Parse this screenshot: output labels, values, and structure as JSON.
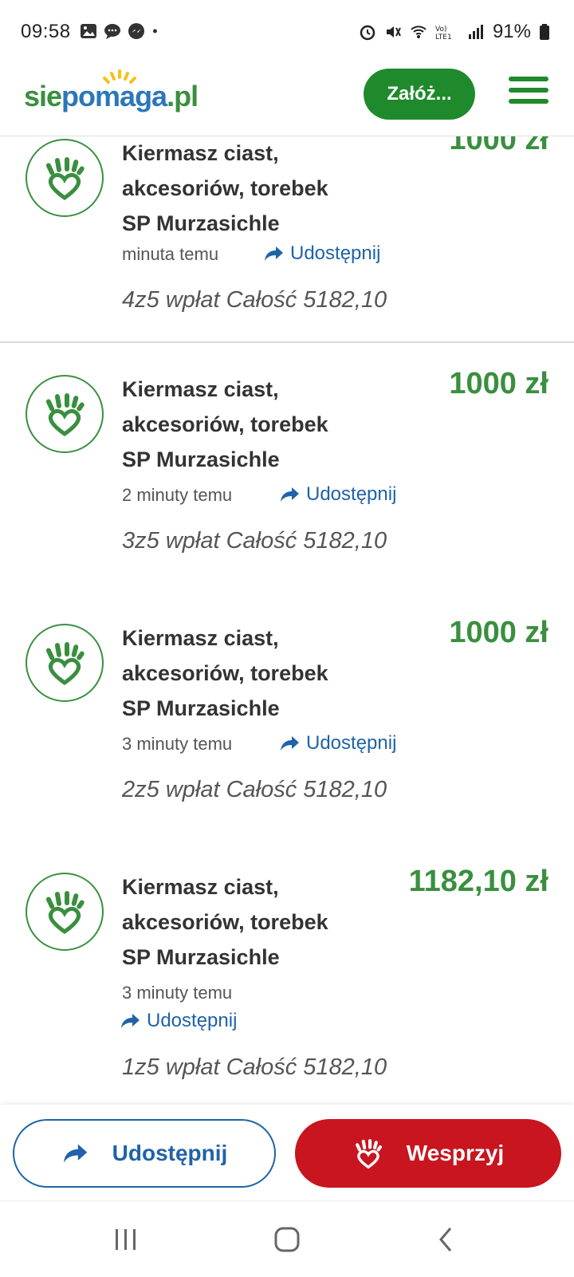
{
  "status_bar": {
    "time": "09:58",
    "battery": "91%",
    "left_icons": [
      "gallery-icon",
      "chat-icon",
      "messenger-icon",
      "dot-icon"
    ],
    "right_icons": [
      "alarm-icon",
      "mute-icon",
      "wifi-icon",
      "volte-icon",
      "signal-icon",
      "battery-icon"
    ]
  },
  "header": {
    "logo_text": {
      "part1": "sie",
      "part2": "po",
      "part3": "maga",
      "part4": ".pl"
    },
    "cta_label": "Załóż...",
    "menu_icon": "hamburger-icon"
  },
  "colors": {
    "green": "#3a8f3f",
    "cta_green": "#1f8a2c",
    "blue": "#1f63a8",
    "red": "#c8151f"
  },
  "items": [
    {
      "title": "Kiermasz ciast, akcesoriów, torebek SP Murzasichle",
      "amount": "1000 zł",
      "time": "minuta temu",
      "share": "Udostępnij",
      "count": "4z5 wpłat Całość 5182,10"
    },
    {
      "title": "Kiermasz ciast, akcesoriów, torebek SP Murzasichle",
      "amount": "1000 zł",
      "time": "2 minuty temu",
      "share": "Udostępnij",
      "count": "3z5 wpłat Całość 5182,10"
    },
    {
      "title": "Kiermasz ciast, akcesoriów, torebek SP Murzasichle",
      "amount": "1000 zł",
      "time": "3 minuty temu",
      "share": "Udostępnij",
      "count": "2z5 wpłat Całość 5182,10"
    },
    {
      "title": "Kiermasz ciast, akcesoriów, torebek SP Murzasichle",
      "amount": "1182,10 zł",
      "time": "3 minuty temu",
      "share": "Udostępnij",
      "count": "1z5 wpłat Całość 5182,10"
    }
  ],
  "actions": {
    "share_label": "Udostępnij",
    "support_label": "Wesprzyj"
  },
  "nav": {
    "icons": [
      "recent-apps-icon",
      "home-icon",
      "back-icon"
    ]
  }
}
